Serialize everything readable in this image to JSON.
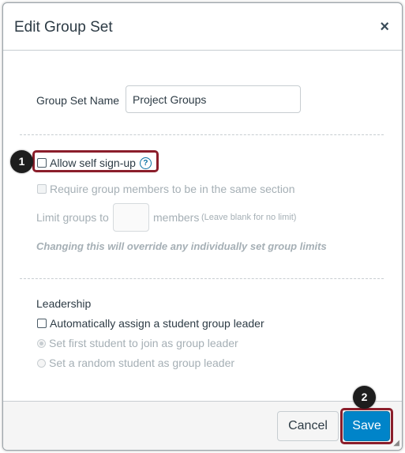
{
  "dialog": {
    "title": "Edit Group Set",
    "close_glyph": "×"
  },
  "form": {
    "group_set_name_label": "Group Set Name",
    "group_set_name_value": "Project Groups",
    "allow_self_signup_label": "Allow self sign-up",
    "help_glyph": "?",
    "require_same_section_label": "Require group members to be in the same section",
    "limit_groups_prefix": "Limit groups to",
    "limit_groups_suffix": "members",
    "limit_groups_hint": "(Leave blank for no limit)",
    "override_warning": "Changing this will override any individually set group limits",
    "leadership_heading": "Leadership",
    "auto_leader_label": "Automatically assign a student group leader",
    "first_student_label": "Set first student to join as group leader",
    "random_student_label": "Set a random student as group leader"
  },
  "callouts": {
    "step1": "1",
    "step2": "2"
  },
  "footer": {
    "cancel_label": "Cancel",
    "save_label": "Save"
  },
  "colors": {
    "accent": "#0084c9",
    "highlight": "#8b1e2b"
  },
  "icons": {
    "close": "close-icon",
    "help": "help-icon",
    "resize": "resize-grip-icon"
  }
}
